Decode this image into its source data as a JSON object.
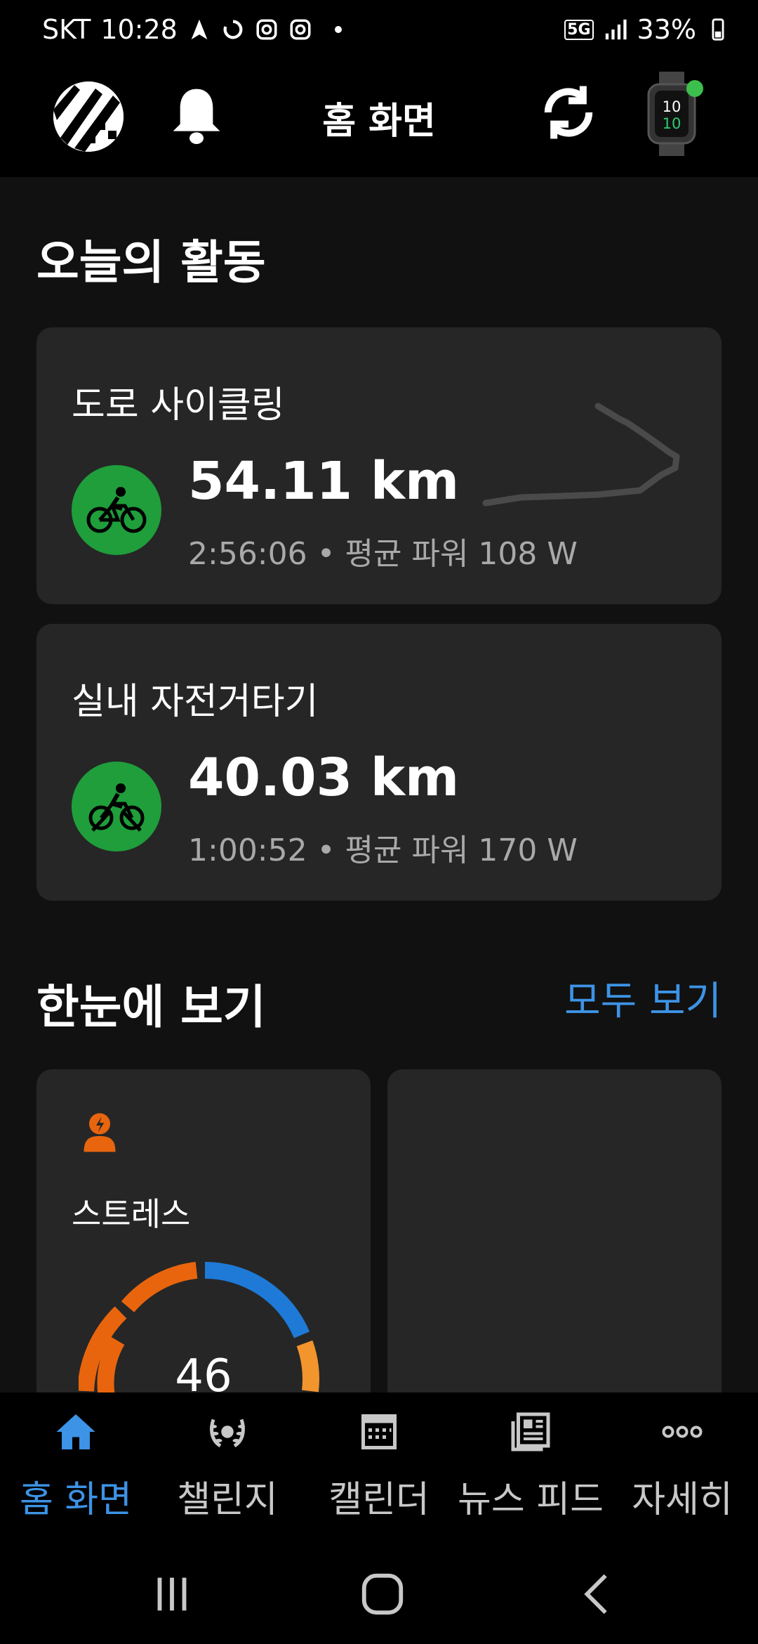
{
  "status_bar": {
    "carrier": "SKT",
    "time": "10:28",
    "network": "5G",
    "battery": "33%"
  },
  "app_bar": {
    "title": "홈 화면"
  },
  "activities": {
    "title": "오늘의 활동",
    "items": [
      {
        "name": "도로 사이클링",
        "distance": "54.11 km",
        "summary": "2:56:06 • 평균 파워 108 W",
        "icon": "road-bike-icon"
      },
      {
        "name": "실내 자전거타기",
        "distance": "40.03 km",
        "summary": "1:00:52 • 평균 파워 170 W",
        "icon": "indoor-bike-icon"
      }
    ]
  },
  "glance": {
    "title": "한눈에 보기",
    "see_all": "모두 보기",
    "stress": {
      "label": "스트레스",
      "value": "46"
    }
  },
  "bottom_nav": {
    "items": [
      {
        "label": "홈 화면",
        "icon": "home-icon",
        "active": true
      },
      {
        "label": "챌린지",
        "icon": "laurel-icon"
      },
      {
        "label": "캘린더",
        "icon": "calendar-icon"
      },
      {
        "label": "뉴스 피드",
        "icon": "newsfeed-icon"
      },
      {
        "label": "자세히",
        "icon": "more-icon"
      }
    ]
  },
  "colors": {
    "accent": "#3d93e6",
    "badge_green": "#1f9e3b",
    "stress_orange": "#e8650e",
    "stress_blue": "#1e7ad6"
  }
}
